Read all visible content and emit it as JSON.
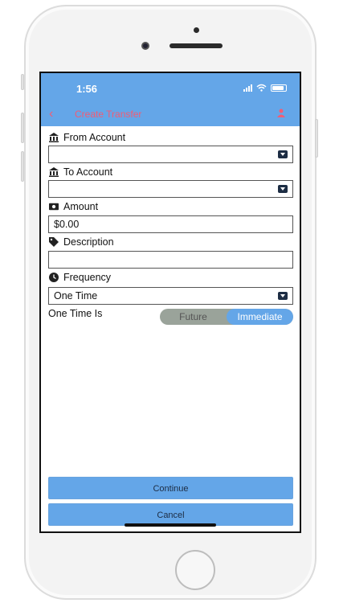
{
  "status": {
    "time": "1:56"
  },
  "nav": {
    "back_icon": "chevron-left-icon",
    "title": "Create Transfer",
    "user_icon": "user-icon"
  },
  "form": {
    "from_account": {
      "label": "From Account",
      "icon": "bank-icon",
      "value": ""
    },
    "to_account": {
      "label": "To Account",
      "icon": "bank-icon",
      "value": ""
    },
    "amount": {
      "label": "Amount",
      "icon": "money-icon",
      "value": "$0.00"
    },
    "description": {
      "label": "Description",
      "icon": "tag-icon",
      "value": ""
    },
    "frequency": {
      "label": "Frequency",
      "icon": "clock-icon",
      "value": "One Time"
    },
    "one_time_is": {
      "label": "One Time Is",
      "options": [
        "Future",
        "Immediate"
      ],
      "selected": "Immediate"
    }
  },
  "actions": {
    "continue_label": "Continue",
    "cancel_label": "Cancel"
  },
  "colors": {
    "primary": "#64a6e8",
    "accent": "#f25c74",
    "dark": "#1d2d44"
  }
}
